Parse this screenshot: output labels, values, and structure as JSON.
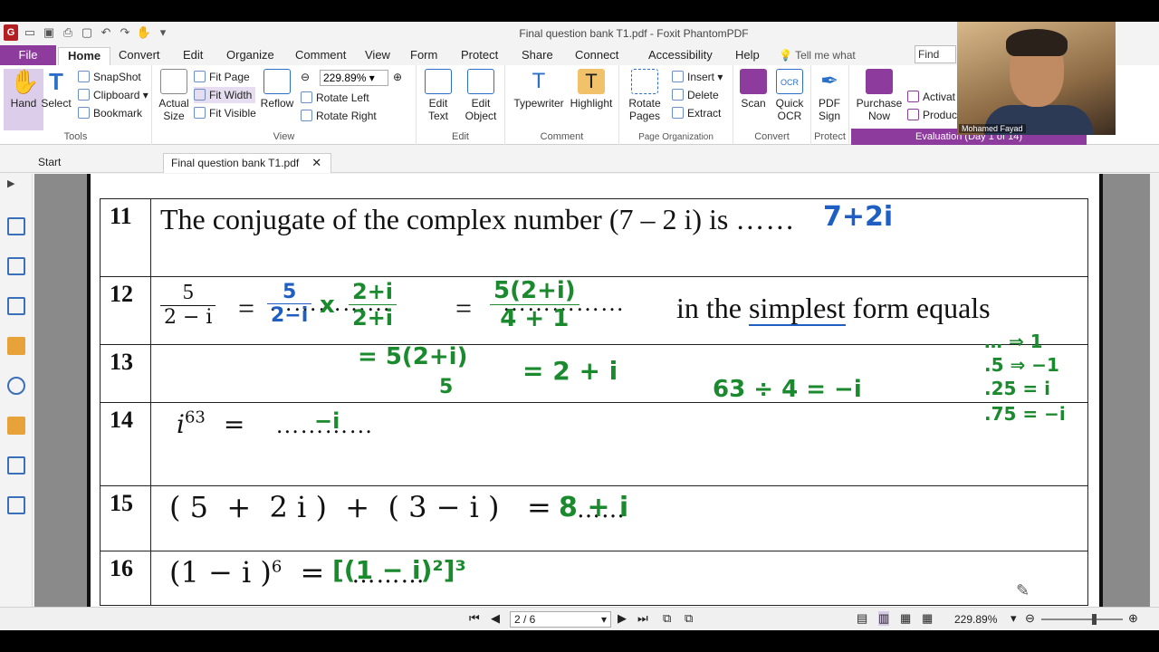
{
  "window": {
    "title": "Final question bank T1.pdf - Foxit PhantomPDF"
  },
  "menu": {
    "tabs": [
      "File",
      "Home",
      "Convert",
      "Edit",
      "Organize",
      "Comment",
      "View",
      "Form",
      "Protect",
      "Share",
      "Connect",
      "Accessibility",
      "Help"
    ],
    "tell_me": "Tell me what",
    "find_placeholder": "Find"
  },
  "ribbon": {
    "hand": "Hand",
    "select": "Select",
    "snapshot": "SnapShot",
    "clipboard": "Clipboard",
    "bookmark": "Bookmark",
    "tools_label": "Tools",
    "actual_size": "Actual Size",
    "fit_page": "Fit Page",
    "fit_width": "Fit Width",
    "fit_visible": "Fit Visible",
    "reflow": "Reflow",
    "zoom": "229.89%",
    "rotate_left": "Rotate Left",
    "rotate_right": "Rotate Right",
    "view_label": "View",
    "edit_text": "Edit Text",
    "edit_object": "Edit Object",
    "edit_label": "Edit",
    "typewriter": "Typewriter",
    "highlight": "Highlight",
    "comment_label": "Comment",
    "rotate_pages": "Rotate Pages",
    "insert": "Insert",
    "delete": "Delete",
    "extract": "Extract",
    "page_org_label": "Page Organization",
    "scan": "Scan",
    "quick_ocr": "Quick OCR",
    "convert_label": "Convert",
    "pdf_sign": "PDF Sign",
    "protect_label": "Protect",
    "purchase_now": "Purchase Now",
    "activate": "Activat",
    "product": "Produc",
    "evaluation": "Evaluation (Day 1 of 14)"
  },
  "doc_tabs": {
    "start": "Start",
    "file": "Final question bank T1.pdf"
  },
  "questions": [
    {
      "num": "11",
      "text": "The conjugate of the complex number (7 – 2 i) is",
      "dots": "……",
      "ink": "7+2i"
    },
    {
      "num": "12",
      "frac_num": "5",
      "frac_den": "2 − i",
      "eq": "=",
      "dots": "……………",
      "suffix_a": "in the ",
      "simplest": "simplest",
      "suffix_b": " form equals"
    },
    {
      "num": "13"
    },
    {
      "num": "14",
      "expr": "i",
      "sup": "63",
      "eq": "=",
      "dots": "…………"
    },
    {
      "num": "15",
      "expr": "( 5  +  2 i )  +  ( 3 − i )   =",
      "dots": "……",
      "ink": "8 + i"
    },
    {
      "num": "16",
      "expr": "(1 − i )",
      "sup": "6",
      "eq": "=",
      "dots": "………"
    }
  ],
  "handwriting": {
    "q12_step1_num": "5",
    "q12_step1_den": "2−i",
    "times": "x",
    "q12_step2_num": "2+i",
    "q12_step2_den": "2+i",
    "q12_result_num": "5(2+i)",
    "q12_result_den": "4 + 1",
    "q13_line": "= 5(2+i)",
    "q13_den": "5",
    "q13_result": "=  2 + i",
    "calc": "63 ÷ 4 = −i",
    "rule1": "… ⇒ 1",
    "rule2": ".5 ⇒ −1",
    "rule3": ".25 = i",
    "rule4": ".75 = −i",
    "q14_ink": "−i",
    "q16_ink": "[(1 − i)²]³"
  },
  "status": {
    "page": "2 / 6",
    "zoom": "229.89%"
  },
  "webcam": {
    "name": "Mohamed Fayad"
  },
  "colors": {
    "accent": "#8e3b9e",
    "ink_blue": "#1f5fc4",
    "ink_green": "#1b8a2e"
  }
}
